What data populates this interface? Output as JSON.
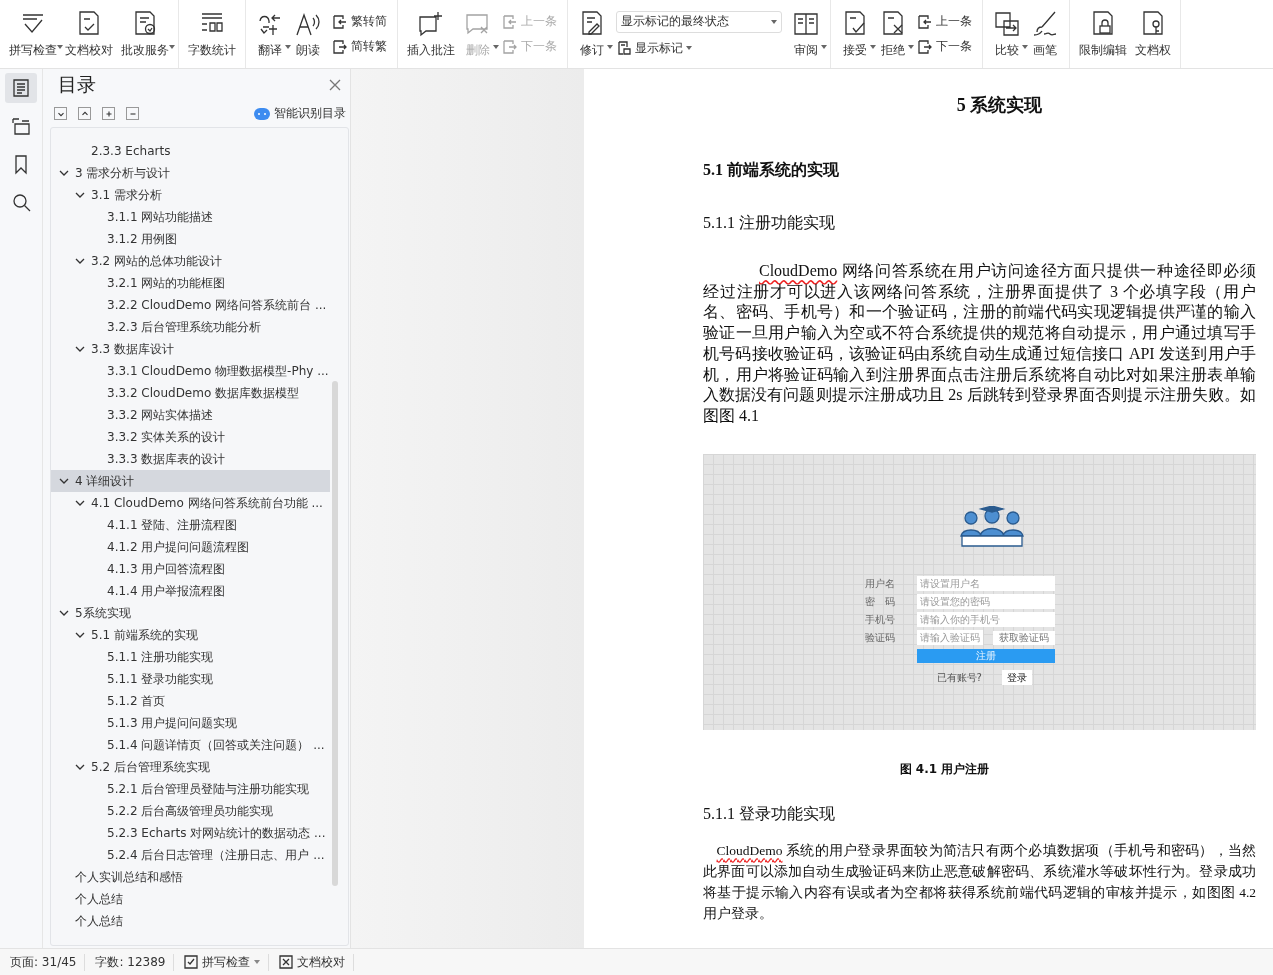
{
  "toolbar": {
    "groups": [
      {
        "items": [
          {
            "kind": "large",
            "label": "拼写检查",
            "caret": true,
            "disabled": false
          },
          {
            "kind": "large",
            "label": "文档校对",
            "caret": false,
            "disabled": false
          },
          {
            "kind": "large",
            "label": "批改服务",
            "caret": true,
            "disabled": false
          }
        ]
      },
      {
        "items": [
          {
            "kind": "large",
            "label": "字数统计",
            "caret": false,
            "disabled": false
          }
        ]
      },
      {
        "items": [
          {
            "kind": "large",
            "label": "翻译",
            "caret": true,
            "disabled": false
          },
          {
            "kind": "large",
            "label": "朗读",
            "caret": false,
            "disabled": false
          },
          {
            "kind": "stack",
            "rows": [
              {
                "label": "繁转简",
                "disabled": false
              },
              {
                "label": "简转繁",
                "disabled": false
              }
            ]
          }
        ]
      },
      {
        "items": [
          {
            "kind": "large",
            "label": "插入批注",
            "caret": false,
            "disabled": false
          },
          {
            "kind": "large",
            "label": "删除",
            "caret": true,
            "disabled": true
          },
          {
            "kind": "stack",
            "rows": [
              {
                "label": "上一条",
                "disabled": true
              },
              {
                "label": "下一条",
                "disabled": true
              }
            ]
          }
        ]
      },
      {
        "items": [
          {
            "kind": "large",
            "label": "修订",
            "caret": true,
            "disabled": false
          },
          {
            "kind": "select",
            "value": "显示标记的最终状态",
            "label": "显示标记"
          },
          {
            "kind": "large",
            "label": "审阅",
            "caret": true,
            "disabled": false
          }
        ]
      },
      {
        "items": [
          {
            "kind": "large",
            "label": "接受",
            "caret": true,
            "disabled": false
          },
          {
            "kind": "large",
            "label": "拒绝",
            "caret": true,
            "disabled": false
          },
          {
            "kind": "stack",
            "rows": [
              {
                "label": "上一条",
                "disabled": false
              },
              {
                "label": "下一条",
                "disabled": false
              }
            ]
          }
        ]
      },
      {
        "items": [
          {
            "kind": "large",
            "label": "比较",
            "caret": true,
            "disabled": false
          },
          {
            "kind": "large",
            "label": "画笔",
            "caret": false,
            "disabled": false
          }
        ]
      },
      {
        "items": [
          {
            "kind": "large",
            "label": "限制编辑",
            "caret": false,
            "disabled": false
          },
          {
            "kind": "large",
            "label": "文档权",
            "caret": false,
            "disabled": false
          }
        ]
      }
    ]
  },
  "rail": [
    {
      "selected": true
    },
    {
      "selected": false
    },
    {
      "selected": false
    },
    {
      "selected": false
    }
  ],
  "toc": {
    "title": "目录",
    "smart_button": "智能识别目录",
    "items": [
      {
        "children": [
          {
            "label": "2.3.3 Echarts",
            "selected": false
          }
        ]
      },
      {
        "label": "3  需求分析与设计",
        "expanded": true,
        "selected": false,
        "children": [
          {
            "label": "3.1 需求分析",
            "expanded": true,
            "selected": false,
            "children": [
              {
                "label": "3.1.1  网站功能描述",
                "selected": false
              },
              {
                "label": "3.1.2  用例图",
                "selected": false
              }
            ]
          },
          {
            "label": "3.2  网站的总体功能设计",
            "expanded": true,
            "selected": false,
            "children": [
              {
                "label": "3.2.1 网站的功能框图",
                "selected": false
              },
              {
                "label": "3.2.2 CloudDemo 网络问答系统前台 ...",
                "selected": false
              },
              {
                "label": "3.2.3 后台管理系统功能分析",
                "selected": false
              }
            ]
          },
          {
            "label": "3.3 数据库设计",
            "expanded": true,
            "selected": false,
            "children": [
              {
                "label": "3.3.1 CloudDemo 物理数据模型-Phy ...",
                "selected": false
              },
              {
                "label": "3.3.2 CloudDemo 数据库数据模型",
                "selected": false
              },
              {
                "label": "3.3.2  网站实体描述",
                "selected": false
              },
              {
                "label": "3.3.2  实体关系的设计",
                "selected": false
              },
              {
                "label": "3.3.3  数据库表的设计",
                "selected": false
              }
            ]
          }
        ]
      },
      {
        "label": "4  详细设计",
        "expanded": true,
        "selected": true,
        "children": [
          {
            "label": "4.1 CloudDemo 网络问答系统前台功能 ...",
            "expanded": true,
            "selected": false,
            "children": [
              {
                "label": "4.1.1  登陆、注册流程图",
                "selected": false
              },
              {
                "label": "4.1.2  用户提问问题流程图",
                "selected": false
              },
              {
                "label": "4.1.3  用户回答流程图",
                "selected": false
              },
              {
                "label": "4.1.4  用户举报流程图",
                "selected": false
              }
            ]
          }
        ]
      },
      {
        "label": "5系统实现",
        "expanded": true,
        "selected": false,
        "children": [
          {
            "label": "5.1  前端系统的实现",
            "expanded": true,
            "selected": false,
            "children": [
              {
                "label": "5.1.1 注册功能实现",
                "selected": false
              },
              {
                "label": "5.1.1 登录功能实现",
                "selected": false
              },
              {
                "label": "5.1.2  首页",
                "selected": false
              },
              {
                "label": "5.1.3  用户提问问题实现",
                "selected": false
              },
              {
                "label": "5.1.4  问题详情页（回答或关注问题） ...",
                "selected": false
              }
            ]
          },
          {
            "label": "5.2  后台管理系统实现",
            "expanded": true,
            "selected": false,
            "children": [
              {
                "label": "5.2.1  后台管理员登陆与注册功能实现",
                "selected": false
              },
              {
                "label": "5.2.2  后台高级管理员功能实现",
                "selected": false
              },
              {
                "label": "5.2.3 Echarts 对网站统计的数据动态 ...",
                "selected": false
              },
              {
                "label": "5.2.4  后台日志管理（注册日志、用户 ...",
                "selected": false
              }
            ]
          }
        ]
      },
      {
        "label": "个人实训总结和感悟",
        "selected": false
      },
      {
        "label": "个人总结",
        "selected": false
      },
      {
        "label": "个人总结",
        "selected": false
      }
    ]
  },
  "document": {
    "chapter": "5   系统实现",
    "section": "5.1  前端系统的实现",
    "subsection": "5.1.1 注册功能实现",
    "paragraph_1": {
      "misspelled": "CloudDemo",
      "text": " 网络问答系统在用户访问途径方面只提供一种途径即必须经过注册才可以进入该网络问答系统，注册界面提供了 3 个必填字段（用户名、密码、手机号）和一个验证码，注册的前端代码实现逻辑提供严谨的输入验证一旦用户输入为空或不符合系统提供的规范将自动提示，用户通过填写手机号码接收验证码，该验证码由系统自动生成通过短信接口 API 发送到用户手机，用户将验证码输入到注册界面点击注册后系统将自动比对如果注册表单输入数据没有问题则提示注册成功且 2s 后跳转到登录界面否则提示注册失败。如图图 4.1"
    },
    "figure": {
      "fields": [
        {
          "label": "用户名",
          "placeholder": "请设置用户名"
        },
        {
          "label": "密　码",
          "placeholder": "请设置您的密码"
        },
        {
          "label": "手机号",
          "placeholder": "请输入你的手机号"
        },
        {
          "label": "验证码",
          "placeholder": "请输入验证码",
          "button": "获取验证码"
        }
      ],
      "register": "注册",
      "have_account": "已有账号?",
      "login": "登录"
    },
    "caption": "图 4.1  用户注册",
    "subsection_2": "5.1.1 登录功能实现",
    "paragraph_2": {
      "misspelled": "CloudDemo",
      "text": " 系统的用户登录界面较为简洁只有两个必填数据项（手机号和密码），当然此界面可以添加自动生成验证码来防止恶意破解密码、系统灌水等破坏性行为。登录成功将基于提示输入内容有误或者为空都将获得系统前端代码逻辑的审核并提示，如图图 4.2 用户登录。"
    }
  },
  "status_bar": {
    "page": "页面: 31/45",
    "words": "字数: 12389",
    "spell_check": "拼写检查",
    "proofread": "文档校对"
  }
}
